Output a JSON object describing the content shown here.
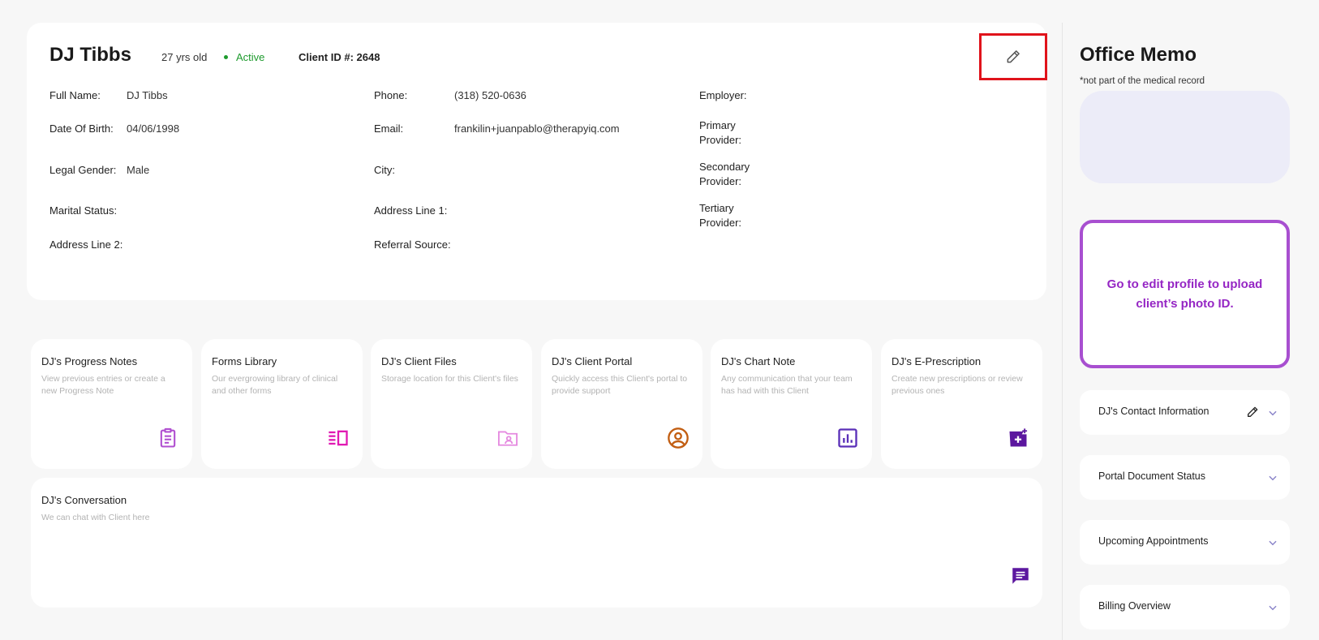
{
  "client": {
    "name": "DJ Tibbs",
    "age": "27 yrs old",
    "status": "Active",
    "id_label": "Client ID #: 2648"
  },
  "details": {
    "full_name_label": "Full Name:",
    "full_name": "DJ Tibbs",
    "dob_label": "Date Of Birth:",
    "dob": "04/06/1998",
    "gender_label": "Legal Gender:",
    "gender": "Male",
    "marital_label": "Marital Status:",
    "address2_label": "Address Line 2:",
    "phone_label": "Phone:",
    "phone": "(318) 520-0636",
    "email_label": "Email:",
    "email": "frankilin+juanpablo@therapyiq.com",
    "city_label": "City:",
    "address1_label": "Address Line 1:",
    "referral_label": "Referral Source:",
    "employer_label": "Employer:",
    "primary_label_1": "Primary",
    "primary_label_2": "Provider:",
    "secondary_label_1": "Secondary",
    "secondary_label_2": "Provider:",
    "tertiary_label_1": "Tertiary",
    "tertiary_label_2": "Provider:"
  },
  "tiles": [
    {
      "title": "DJ's Progress Notes",
      "desc": "View previous entries or create a new Progress Note",
      "icon": "clipboard-icon",
      "color": "#b04fd0"
    },
    {
      "title": "Forms Library",
      "desc": "Our evergrowing library of clinical and other forms",
      "icon": "forms-library-icon",
      "color": "#e11ab3"
    },
    {
      "title": "DJ's Client Files",
      "desc": "Storage location for this Client's files",
      "icon": "folder-user-icon",
      "color": "#e58ae0"
    },
    {
      "title": "DJ's Client Portal",
      "desc": "Quickly access this Client's portal to provide support",
      "icon": "user-circle-icon",
      "color": "#c25e12"
    },
    {
      "title": "DJ's Chart Note",
      "desc": "Any communication that your team has had with this Client",
      "icon": "bar-chart-icon",
      "color": "#5a2fb8"
    },
    {
      "title": "DJ's E-Prescription",
      "desc": "Create new prescriptions or review previous ones",
      "icon": "prescription-icon",
      "color": "#5c179f"
    }
  ],
  "conversation": {
    "title": "DJ's Conversation",
    "desc": "We can chat with Client here",
    "icon": "chat-icon",
    "color": "#5c179f"
  },
  "memo": {
    "title": "Office Memo",
    "note": "*not part of the medical record"
  },
  "photo_prompt": "Go to edit profile to upload client’s photo ID.",
  "sidebar": {
    "sections": [
      {
        "label": "DJ's Contact Information"
      },
      {
        "label": "Portal Document Status"
      },
      {
        "label": "Upcoming Appointments"
      },
      {
        "label": "Billing Overview"
      }
    ]
  },
  "colors": {
    "active": "#1e9b2e",
    "highlight": "#e0131b",
    "accent": "#9526c4",
    "memo_bg": "#ececf8"
  }
}
